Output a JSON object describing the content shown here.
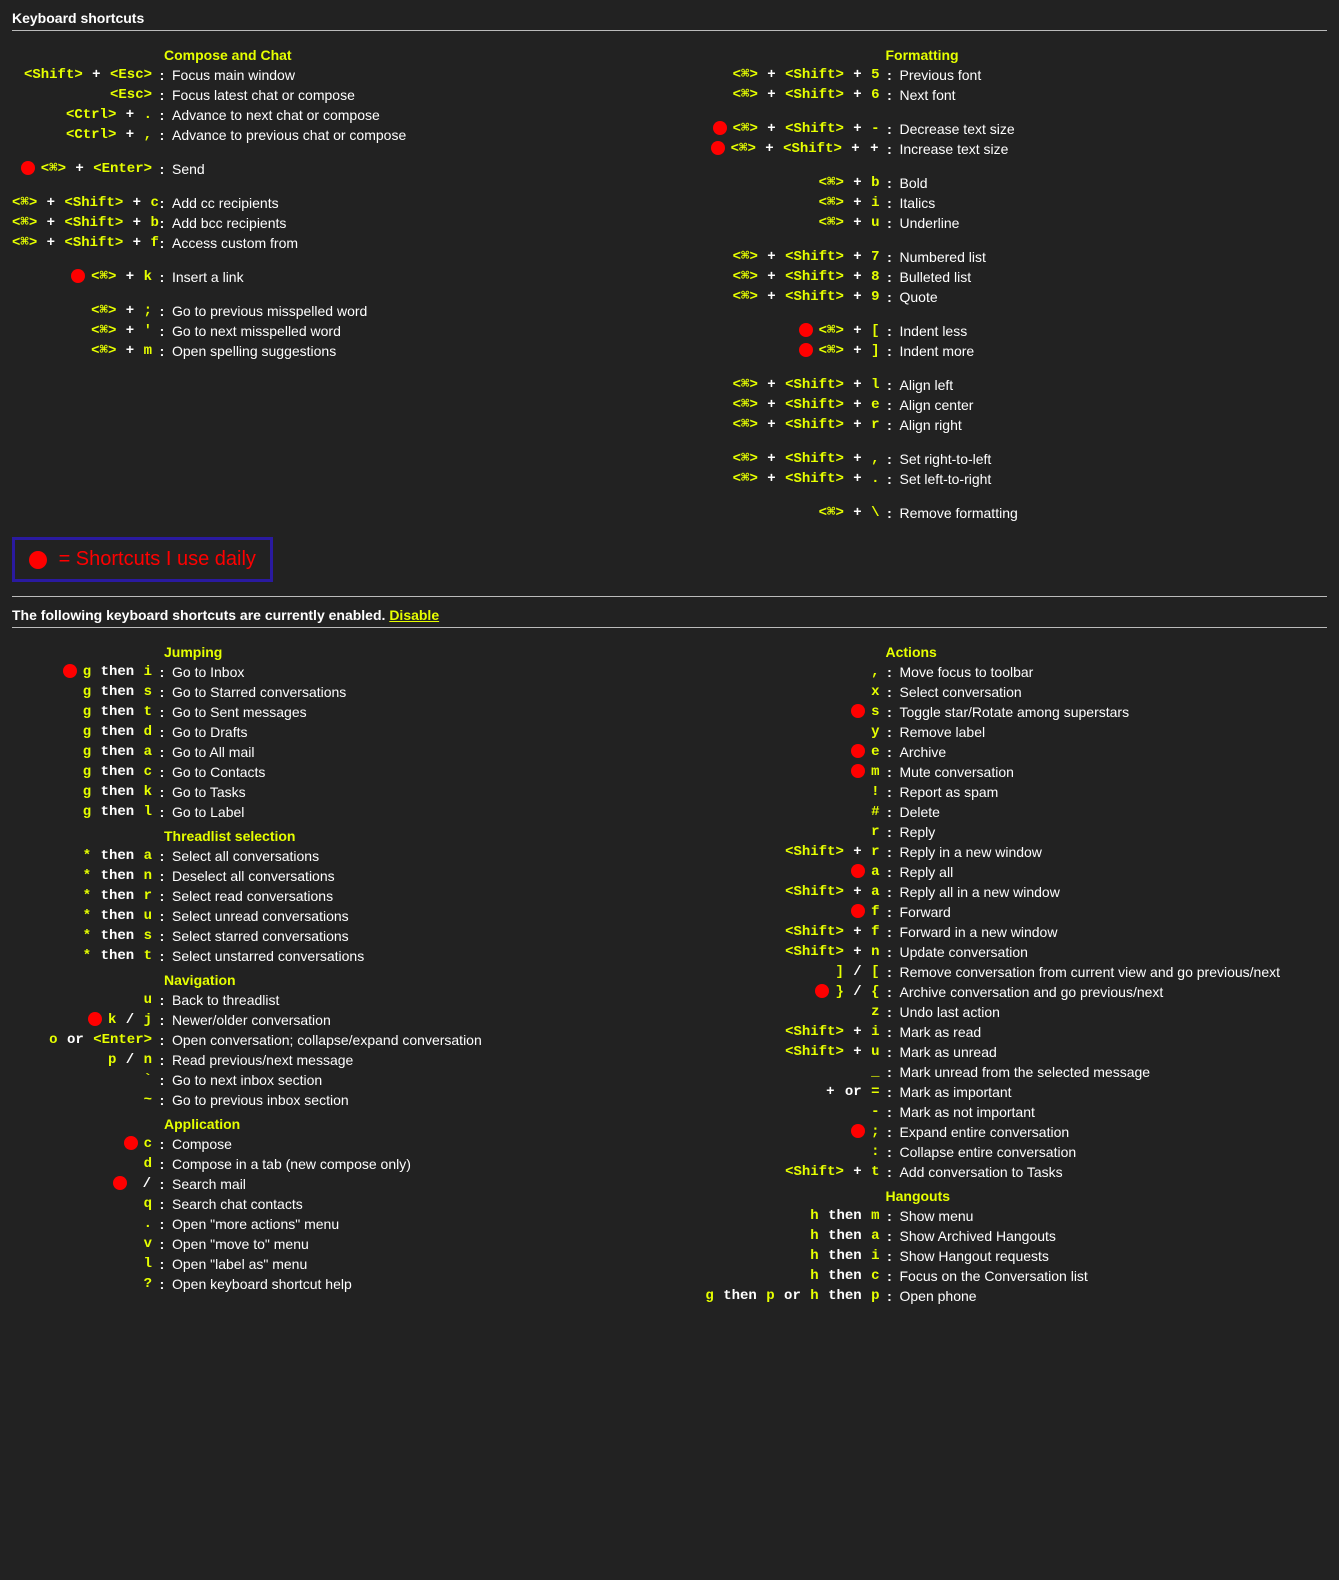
{
  "header": "Keyboard shortcuts",
  "legend_text": "= Shortcuts I use daily",
  "enabled_text_prefix": "The following keyboard shortcuts are currently enabled. ",
  "disable_label": "Disable",
  "sections_top_left": [
    {
      "title": "Compose and Chat",
      "rows": [
        {
          "keys": [
            "<Shift>",
            "+",
            "<Esc>"
          ],
          "desc": "Focus main window"
        },
        {
          "keys": [
            "<Esc>"
          ],
          "desc": "Focus latest chat or compose"
        },
        {
          "keys": [
            "<Ctrl>",
            "+",
            "."
          ],
          "desc": "Advance to next chat or compose"
        },
        {
          "keys": [
            "<Ctrl>",
            "+",
            ","
          ],
          "desc": "Advance to previous chat or compose"
        },
        {
          "spacer": true
        },
        {
          "dot": true,
          "keys": [
            "<⌘>",
            "+",
            "<Enter>"
          ],
          "desc": "Send"
        },
        {
          "spacer": true
        },
        {
          "keys": [
            "<⌘>",
            "+",
            "<Shift>",
            "+",
            "c"
          ],
          "desc": "Add cc recipients"
        },
        {
          "keys": [
            "<⌘>",
            "+",
            "<Shift>",
            "+",
            "b"
          ],
          "desc": "Add bcc recipients"
        },
        {
          "keys": [
            "<⌘>",
            "+",
            "<Shift>",
            "+",
            "f"
          ],
          "desc": "Access custom from"
        },
        {
          "spacer": true
        },
        {
          "dot": true,
          "keys": [
            "<⌘>",
            "+",
            "k"
          ],
          "desc": "Insert a link"
        },
        {
          "spacer": true
        },
        {
          "keys": [
            "<⌘>",
            "+",
            ";"
          ],
          "desc": "Go to previous misspelled word"
        },
        {
          "keys": [
            "<⌘>",
            "+",
            "'"
          ],
          "desc": "Go to next misspelled word"
        },
        {
          "keys": [
            "<⌘>",
            "+",
            "m"
          ],
          "desc": "Open spelling suggestions"
        }
      ]
    }
  ],
  "sections_top_right": [
    {
      "title": "Formatting",
      "rows": [
        {
          "keys": [
            "<⌘>",
            "+",
            "<Shift>",
            "+",
            "5"
          ],
          "desc": "Previous font"
        },
        {
          "keys": [
            "<⌘>",
            "+",
            "<Shift>",
            "+",
            "6"
          ],
          "desc": "Next font"
        },
        {
          "spacer": true
        },
        {
          "dot": true,
          "keys": [
            "<⌘>",
            "+",
            "<Shift>",
            "+",
            "-"
          ],
          "desc": "Decrease text size"
        },
        {
          "dot": true,
          "keys": [
            "<⌘>",
            "+",
            "<Shift>",
            "+",
            "+"
          ],
          "desc": "Increase text size"
        },
        {
          "spacer": true
        },
        {
          "keys": [
            "<⌘>",
            "+",
            "b"
          ],
          "desc": "Bold"
        },
        {
          "keys": [
            "<⌘>",
            "+",
            "i"
          ],
          "desc": "Italics"
        },
        {
          "keys": [
            "<⌘>",
            "+",
            "u"
          ],
          "desc": "Underline"
        },
        {
          "spacer": true
        },
        {
          "keys": [
            "<⌘>",
            "+",
            "<Shift>",
            "+",
            "7"
          ],
          "desc": "Numbered list"
        },
        {
          "keys": [
            "<⌘>",
            "+",
            "<Shift>",
            "+",
            "8"
          ],
          "desc": "Bulleted list"
        },
        {
          "keys": [
            "<⌘>",
            "+",
            "<Shift>",
            "+",
            "9"
          ],
          "desc": "Quote"
        },
        {
          "spacer": true
        },
        {
          "dot": true,
          "keys": [
            "<⌘>",
            "+",
            "["
          ],
          "desc": "Indent less"
        },
        {
          "dot": true,
          "keys": [
            "<⌘>",
            "+",
            "]"
          ],
          "desc": "Indent more"
        },
        {
          "spacer": true
        },
        {
          "keys": [
            "<⌘>",
            "+",
            "<Shift>",
            "+",
            "l"
          ],
          "desc": "Align left"
        },
        {
          "keys": [
            "<⌘>",
            "+",
            "<Shift>",
            "+",
            "e"
          ],
          "desc": "Align center"
        },
        {
          "keys": [
            "<⌘>",
            "+",
            "<Shift>",
            "+",
            "r"
          ],
          "desc": "Align right"
        },
        {
          "spacer": true
        },
        {
          "keys": [
            "<⌘>",
            "+",
            "<Shift>",
            "+",
            ","
          ],
          "desc": "Set right-to-left"
        },
        {
          "keys": [
            "<⌘>",
            "+",
            "<Shift>",
            "+",
            "."
          ],
          "desc": "Set left-to-right"
        },
        {
          "spacer": true
        },
        {
          "keys": [
            "<⌘>",
            "+",
            "\\"
          ],
          "desc": "Remove formatting"
        }
      ]
    }
  ],
  "sections_bottom_left": [
    {
      "title": "Jumping",
      "rows": [
        {
          "dot": true,
          "keys": [
            "g",
            "then",
            "i"
          ],
          "desc": "Go to Inbox"
        },
        {
          "keys": [
            "g",
            "then",
            "s"
          ],
          "desc": "Go to Starred conversations"
        },
        {
          "keys": [
            "g",
            "then",
            "t"
          ],
          "desc": "Go to Sent messages"
        },
        {
          "keys": [
            "g",
            "then",
            "d"
          ],
          "desc": "Go to Drafts"
        },
        {
          "keys": [
            "g",
            "then",
            "a"
          ],
          "desc": "Go to All mail"
        },
        {
          "keys": [
            "g",
            "then",
            "c"
          ],
          "desc": "Go to Contacts"
        },
        {
          "keys": [
            "g",
            "then",
            "k"
          ],
          "desc": "Go to Tasks"
        },
        {
          "keys": [
            "g",
            "then",
            "l"
          ],
          "desc": "Go to Label"
        }
      ]
    },
    {
      "title": "Threadlist selection",
      "rows": [
        {
          "keys": [
            "*",
            "then",
            "a"
          ],
          "desc": "Select all conversations"
        },
        {
          "keys": [
            "*",
            "then",
            "n"
          ],
          "desc": "Deselect all conversations"
        },
        {
          "keys": [
            "*",
            "then",
            "r"
          ],
          "desc": "Select read conversations"
        },
        {
          "keys": [
            "*",
            "then",
            "u"
          ],
          "desc": "Select unread conversations"
        },
        {
          "keys": [
            "*",
            "then",
            "s"
          ],
          "desc": "Select starred conversations"
        },
        {
          "keys": [
            "*",
            "then",
            "t"
          ],
          "desc": "Select unstarred conversations"
        }
      ]
    },
    {
      "title": "Navigation",
      "rows": [
        {
          "keys": [
            "u"
          ],
          "desc": "Back to threadlist"
        },
        {
          "dot": true,
          "keys": [
            "k",
            "/",
            "j"
          ],
          "desc": "Newer/older conversation"
        },
        {
          "keys": [
            "o",
            "or",
            "<Enter>"
          ],
          "desc": "Open conversation; collapse/expand conversation"
        },
        {
          "keys": [
            "p",
            "/",
            "n"
          ],
          "desc": "Read previous/next message"
        },
        {
          "keys": [
            "`"
          ],
          "desc": "Go to next inbox section"
        },
        {
          "keys": [
            "~"
          ],
          "desc": "Go to previous inbox section"
        }
      ]
    },
    {
      "title": "Application",
      "rows": [
        {
          "dot": true,
          "keys": [
            "c"
          ],
          "desc": "Compose"
        },
        {
          "keys": [
            "d"
          ],
          "desc": "Compose in a tab (new compose only)"
        },
        {
          "dot": true,
          "keys": [
            "/"
          ],
          "desc": "Search mail"
        },
        {
          "keys": [
            "q"
          ],
          "desc": "Search chat contacts"
        },
        {
          "keys": [
            "."
          ],
          "desc": "Open \"more actions\" menu"
        },
        {
          "keys": [
            "v"
          ],
          "desc": "Open \"move to\" menu"
        },
        {
          "keys": [
            "l"
          ],
          "desc": "Open \"label as\" menu"
        },
        {
          "keys": [
            "?"
          ],
          "desc": "Open keyboard shortcut help"
        }
      ]
    }
  ],
  "sections_bottom_right": [
    {
      "title": "Actions",
      "rows": [
        {
          "keys": [
            ","
          ],
          "desc": "Move focus to toolbar"
        },
        {
          "keys": [
            "x"
          ],
          "desc": "Select conversation"
        },
        {
          "dot": true,
          "keys": [
            "s"
          ],
          "desc": "Toggle star/Rotate among superstars"
        },
        {
          "keys": [
            "y"
          ],
          "desc": "Remove label"
        },
        {
          "dot": true,
          "keys": [
            "e"
          ],
          "desc": "Archive"
        },
        {
          "dot": true,
          "keys": [
            "m"
          ],
          "desc": "Mute conversation"
        },
        {
          "keys": [
            "!"
          ],
          "desc": "Report as spam"
        },
        {
          "keys": [
            "#"
          ],
          "desc": "Delete"
        },
        {
          "keys": [
            "r"
          ],
          "desc": "Reply"
        },
        {
          "keys": [
            "<Shift>",
            "+",
            "r"
          ],
          "desc": "Reply in a new window"
        },
        {
          "dot": true,
          "keys": [
            "a"
          ],
          "desc": "Reply all"
        },
        {
          "keys": [
            "<Shift>",
            "+",
            "a"
          ],
          "desc": "Reply all in a new window"
        },
        {
          "dot": true,
          "keys": [
            "f"
          ],
          "desc": "Forward"
        },
        {
          "keys": [
            "<Shift>",
            "+",
            "f"
          ],
          "desc": "Forward in a new window"
        },
        {
          "keys": [
            "<Shift>",
            "+",
            "n"
          ],
          "desc": "Update conversation"
        },
        {
          "keys": [
            "]",
            "/",
            "["
          ],
          "desc": "Remove conversation from current view and go previous/next"
        },
        {
          "dot": true,
          "keys": [
            "}",
            "/",
            "{"
          ],
          "desc": "Archive conversation and go previous/next"
        },
        {
          "keys": [
            "z"
          ],
          "desc": "Undo last action"
        },
        {
          "keys": [
            "<Shift>",
            "+",
            "i"
          ],
          "desc": "Mark as read"
        },
        {
          "keys": [
            "<Shift>",
            "+",
            "u"
          ],
          "desc": "Mark as unread"
        },
        {
          "keys": [
            "_"
          ],
          "desc": "Mark unread from the selected message"
        },
        {
          "keys": [
            "+",
            "or",
            "="
          ],
          "desc": "Mark as important"
        },
        {
          "keys": [
            "-"
          ],
          "desc": "Mark as not important"
        },
        {
          "dot": true,
          "keys": [
            ";"
          ],
          "desc": "Expand entire conversation"
        },
        {
          "keys": [
            ":"
          ],
          "desc": "Collapse entire conversation"
        },
        {
          "keys": [
            "<Shift>",
            "+",
            "t"
          ],
          "desc": "Add conversation to Tasks"
        }
      ]
    },
    {
      "title": "Hangouts",
      "rows": [
        {
          "keys": [
            "h",
            "then",
            "m"
          ],
          "desc": "Show menu"
        },
        {
          "keys": [
            "h",
            "then",
            "a"
          ],
          "desc": "Show Archived Hangouts"
        },
        {
          "keys": [
            "h",
            "then",
            "i"
          ],
          "desc": "Show Hangout requests"
        },
        {
          "keys": [
            "h",
            "then",
            "c"
          ],
          "desc": "Focus on the Conversation list"
        },
        {
          "keys": [
            "g",
            "then",
            "p",
            "or",
            "h",
            "then",
            "p"
          ],
          "desc": "Open phone"
        }
      ]
    }
  ]
}
